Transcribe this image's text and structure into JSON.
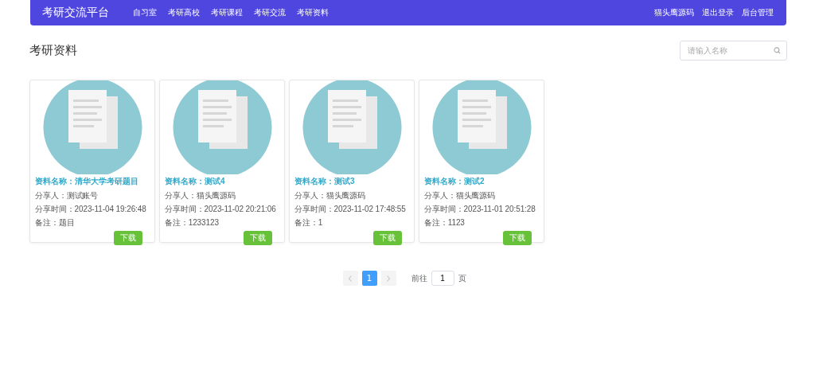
{
  "nav": {
    "brand": "考研交流平台",
    "links": [
      "自习室",
      "考研高校",
      "考研课程",
      "考研交流",
      "考研资料"
    ],
    "right_links": [
      "猫头鹰源码",
      "退出登录",
      "后台管理"
    ]
  },
  "page_title": "考研资料",
  "search": {
    "placeholder": "请输入名称"
  },
  "cards": [
    {
      "name": "资料名称：清华大学考研题目",
      "sharer": "分享人：测试账号",
      "time": "分享时间：2023-11-04 19:26:48",
      "note": "备注：题目",
      "button": "下载"
    },
    {
      "name": "资料名称：测试4",
      "sharer": "分享人：猫头鹰源码",
      "time": "分享时间：2023-11-02 20:21:06",
      "note": "备注：1233123",
      "button": "下载"
    },
    {
      "name": "资料名称：测试3",
      "sharer": "分享人：猫头鹰源码",
      "time": "分享时间：2023-11-02 17:48:55",
      "note": "备注：1",
      "button": "下载"
    },
    {
      "name": "资料名称：测试2",
      "sharer": "分享人：猫头鹰源码",
      "time": "分享时间：2023-11-01 20:51:28",
      "note": "备注：1123",
      "button": "下载"
    }
  ],
  "pagination": {
    "prev_disabled": true,
    "next_disabled": true,
    "pages": [
      {
        "label": "1",
        "selected": true
      }
    ],
    "goto_label": "前往",
    "goto_value": "1",
    "goto_suffix": "页"
  }
}
